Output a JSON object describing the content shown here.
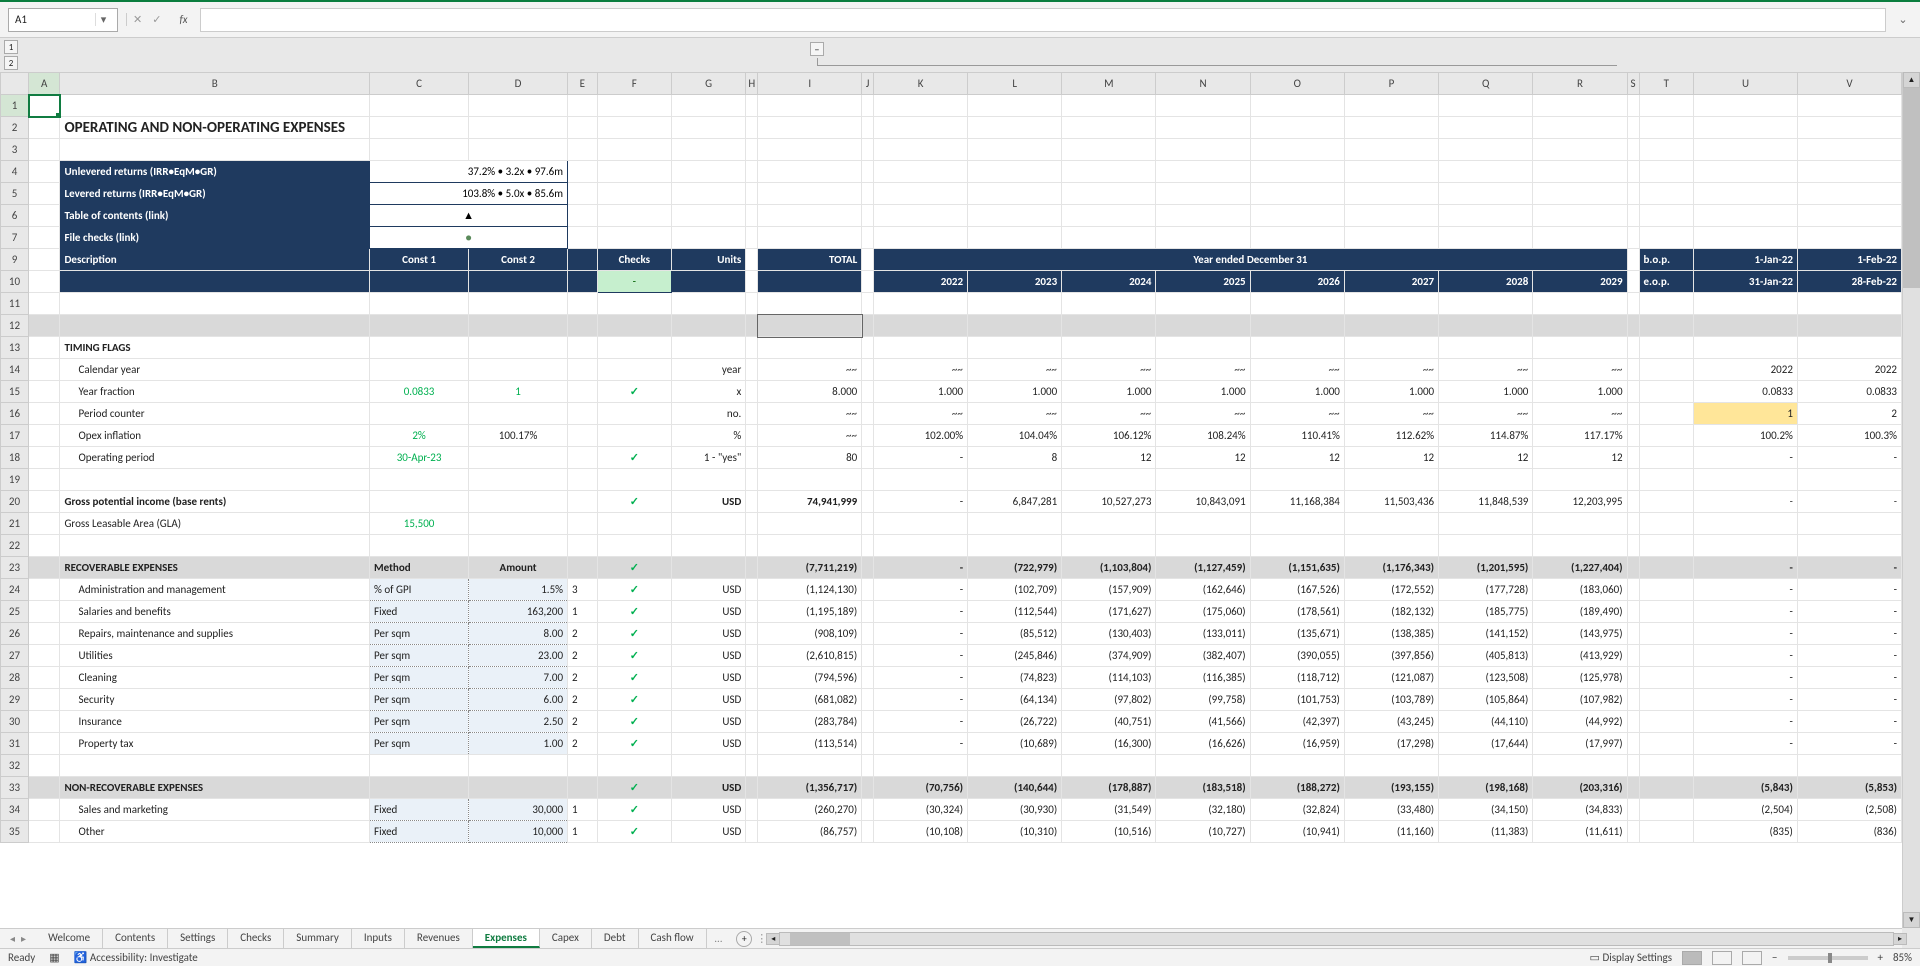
{
  "namebox": "A1",
  "title": "OPERATING AND NON-OPERATING EXPENSES",
  "info": {
    "unlev_lbl": "Unlevered returns (IRR•EqM•GR)",
    "unlev_val": "37.2% • 3.2x • 97.6m",
    "lev_lbl": "Levered returns (IRR•EqM•GR)",
    "lev_val": "103.8% • 5.0x • 85.6m",
    "toc_lbl": "Table of contents (link)",
    "toc_val": "▲",
    "chk_lbl": "File checks (link)",
    "chk_val": "●"
  },
  "hdr": {
    "desc": "Description",
    "c1": "Const 1",
    "c2": "Const 2",
    "checks": "Checks",
    "units": "Units",
    "total": "TOTAL",
    "yearh": "Year ended December 31",
    "years": [
      "2022",
      "2023",
      "2024",
      "2025",
      "2026",
      "2027",
      "2028",
      "2029"
    ],
    "bop": "b.o.p.",
    "eop": "e.o.p.",
    "u1": "1-Jan-22",
    "u2": "1-Feb-22",
    "u1b": "31-Jan-22",
    "u2b": "28-Feb-22",
    "dash": "-"
  },
  "r13": "TIMING FLAGS",
  "r14": {
    "d": "Calendar year",
    "u": "year",
    "t": "~~",
    "y": [
      "~~",
      "~~",
      "~~",
      "~~",
      "~~",
      "~~",
      "~~",
      "~~"
    ],
    "u1": "2022",
    "u2": "2022"
  },
  "r15": {
    "d": "Year fraction",
    "c1": "0.0833",
    "c2": "1",
    "u": "x",
    "t": "8.000",
    "y": [
      "1.000",
      "1.000",
      "1.000",
      "1.000",
      "1.000",
      "1.000",
      "1.000",
      "1.000"
    ],
    "u1": "0.0833",
    "u2": "0.0833"
  },
  "r16": {
    "d": "Period counter",
    "u": "no.",
    "t": "~~",
    "y": [
      "~~",
      "~~",
      "~~",
      "~~",
      "~~",
      "~~",
      "~~",
      "~~"
    ],
    "u1": "1",
    "u2": "2"
  },
  "r17": {
    "d": "Opex inflation",
    "c1": "2%",
    "c2": "100.17%",
    "u": "%",
    "t": "~~",
    "y": [
      "102.00%",
      "104.04%",
      "106.12%",
      "108.24%",
      "110.41%",
      "112.62%",
      "114.87%",
      "117.17%"
    ],
    "u1": "100.2%",
    "u2": "100.3%"
  },
  "r18": {
    "d": "Operating period",
    "c1": "30-Apr-23",
    "u": "1 - \"yes\"",
    "t": "80",
    "y": [
      "-",
      "8",
      "12",
      "12",
      "12",
      "12",
      "12",
      "12"
    ],
    "u1": "-",
    "u2": "-"
  },
  "r20": {
    "d": "Gross potential income (base rents)",
    "u": "USD",
    "t": "74,941,999",
    "y": [
      "-",
      "6,847,281",
      "10,527,273",
      "10,843,091",
      "11,168,384",
      "11,503,436",
      "11,848,539",
      "12,203,995"
    ],
    "u1": "-",
    "u2": "-"
  },
  "r21": {
    "d": "Gross Leasable Area (GLA)",
    "c1": "15,500"
  },
  "r23": {
    "d": "RECOVERABLE EXPENSES",
    "m": "Method",
    "a": "Amount",
    "t": "(7,711,219)",
    "y": [
      "-",
      "(722,979)",
      "(1,103,804)",
      "(1,127,459)",
      "(1,151,635)",
      "(1,176,343)",
      "(1,201,595)",
      "(1,227,404)"
    ],
    "u1": "-",
    "u2": "-"
  },
  "r24": {
    "d": "Administration and management",
    "m": "% of GPI",
    "a": "1.5%",
    "e": "3",
    "u": "USD",
    "t": "(1,124,130)",
    "y": [
      "-",
      "(102,709)",
      "(157,909)",
      "(162,646)",
      "(167,526)",
      "(172,552)",
      "(177,728)",
      "(183,060)"
    ],
    "u1": "-",
    "u2": "-"
  },
  "r25": {
    "d": "Salaries and benefits",
    "m": "Fixed",
    "a": "163,200",
    "e": "1",
    "u": "USD",
    "t": "(1,195,189)",
    "y": [
      "-",
      "(112,544)",
      "(171,627)",
      "(175,060)",
      "(178,561)",
      "(182,132)",
      "(185,775)",
      "(189,490)"
    ],
    "u1": "-",
    "u2": "-"
  },
  "r26": {
    "d": "Repairs, maintenance and supplies",
    "m": "Per sqm",
    "a": "8.00",
    "e": "2",
    "u": "USD",
    "t": "(908,109)",
    "y": [
      "-",
      "(85,512)",
      "(130,403)",
      "(133,011)",
      "(135,671)",
      "(138,385)",
      "(141,152)",
      "(143,975)"
    ],
    "u1": "-",
    "u2": "-"
  },
  "r27": {
    "d": "Utilities",
    "m": "Per sqm",
    "a": "23.00",
    "e": "2",
    "u": "USD",
    "t": "(2,610,815)",
    "y": [
      "-",
      "(245,846)",
      "(374,909)",
      "(382,407)",
      "(390,055)",
      "(397,856)",
      "(405,813)",
      "(413,929)"
    ],
    "u1": "-",
    "u2": "-"
  },
  "r28": {
    "d": "Cleaning",
    "m": "Per sqm",
    "a": "7.00",
    "e": "2",
    "u": "USD",
    "t": "(794,596)",
    "y": [
      "-",
      "(74,823)",
      "(114,103)",
      "(116,385)",
      "(118,712)",
      "(121,087)",
      "(123,508)",
      "(125,978)"
    ],
    "u1": "-",
    "u2": "-"
  },
  "r29": {
    "d": "Security",
    "m": "Per sqm",
    "a": "6.00",
    "e": "2",
    "u": "USD",
    "t": "(681,082)",
    "y": [
      "-",
      "(64,134)",
      "(97,802)",
      "(99,758)",
      "(101,753)",
      "(103,789)",
      "(105,864)",
      "(107,982)"
    ],
    "u1": "-",
    "u2": "-"
  },
  "r30": {
    "d": "Insurance",
    "m": "Per sqm",
    "a": "2.50",
    "e": "2",
    "u": "USD",
    "t": "(283,784)",
    "y": [
      "-",
      "(26,722)",
      "(40,751)",
      "(41,566)",
      "(42,397)",
      "(43,245)",
      "(44,110)",
      "(44,992)"
    ],
    "u1": "-",
    "u2": "-"
  },
  "r31": {
    "d": "Property tax",
    "m": "Per sqm",
    "a": "1.00",
    "e": "2",
    "u": "USD",
    "t": "(113,514)",
    "y": [
      "-",
      "(10,689)",
      "(16,300)",
      "(16,626)",
      "(16,959)",
      "(17,298)",
      "(17,644)",
      "(17,997)"
    ],
    "u1": "-",
    "u2": "-"
  },
  "r33": {
    "d": "NON-RECOVERABLE EXPENSES",
    "u": "USD",
    "t": "(1,356,717)",
    "y": [
      "(70,756)",
      "(140,644)",
      "(178,887)",
      "(183,518)",
      "(188,272)",
      "(193,155)",
      "(198,168)",
      "(203,316)"
    ],
    "u1": "(5,843)",
    "u2": "(5,853)"
  },
  "r34": {
    "d": "Sales and marketing",
    "m": "Fixed",
    "a": "30,000",
    "e": "1",
    "u": "USD",
    "t": "(260,270)",
    "y": [
      "(30,324)",
      "(30,930)",
      "(31,549)",
      "(32,180)",
      "(32,824)",
      "(33,480)",
      "(34,150)",
      "(34,833)"
    ],
    "u1": "(2,504)",
    "u2": "(2,508)"
  },
  "r35": {
    "d": "Other",
    "m": "Fixed",
    "a": "10,000",
    "e": "1",
    "u": "USD",
    "t": "(86,757)",
    "y": [
      "(10,108)",
      "(10,310)",
      "(10,516)",
      "(10,727)",
      "(10,941)",
      "(11,160)",
      "(11,383)",
      "(11,611)"
    ],
    "u1": "(835)",
    "u2": "(836)"
  },
  "tabs": [
    "Welcome",
    "Contents",
    "Settings",
    "Checks",
    "Summary",
    "Inputs",
    "Revenues",
    "Expenses",
    "Capex",
    "Debt",
    "Cash flow"
  ],
  "active_tab": 7,
  "status": {
    "ready": "Ready",
    "acc": "Accessibility: Investigate",
    "disp": "Display Settings",
    "zoom": "85%"
  },
  "chk": "✓"
}
